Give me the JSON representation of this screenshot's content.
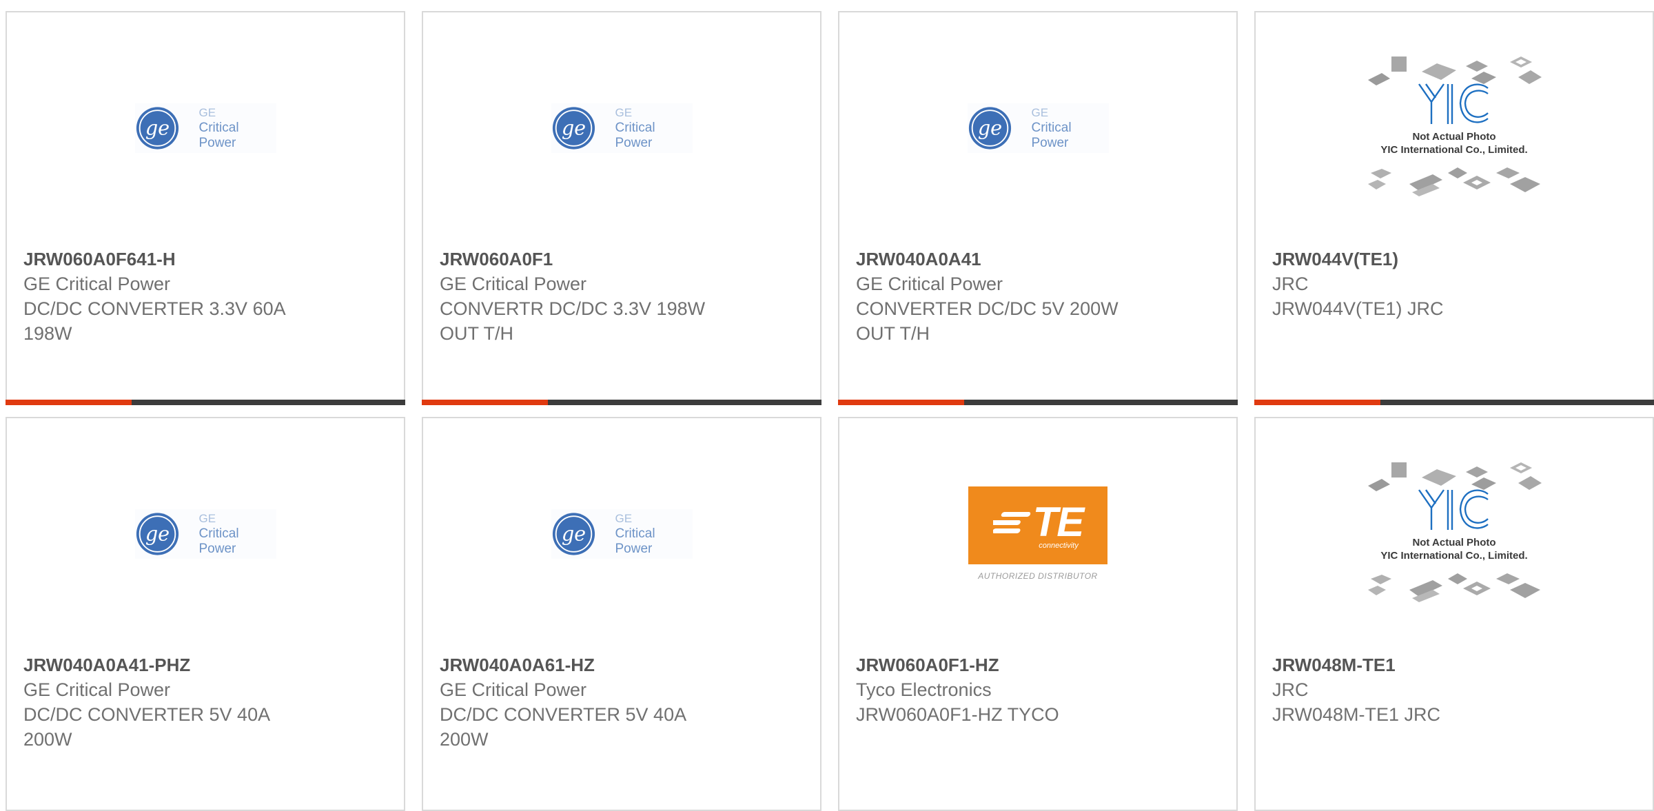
{
  "colors": {
    "accent": "#e03a10",
    "bar_dark": "#3c3c3c",
    "te_orange": "#f08a1c",
    "ge_blue": "#3d6fb6",
    "yic_blue": "#1d6fc1"
  },
  "cards": [
    {
      "part": "JRW060A0F641-H",
      "manufacturer": "GE Critical Power",
      "description": "DC/DC CONVERTER 3.3V 60A 198W",
      "logo": "ge",
      "logo_text": [
        "GE",
        "Critical Power"
      ]
    },
    {
      "part": "JRW060A0F1",
      "manufacturer": "GE Critical Power",
      "description": "CONVERTR DC/DC 3.3V 198W OUT T/H",
      "logo": "ge",
      "logo_text": [
        "GE",
        "Critical Power"
      ]
    },
    {
      "part": "JRW040A0A41",
      "manufacturer": "GE Critical Power",
      "description": "CONVERTER DC/DC 5V 200W OUT T/H",
      "logo": "ge",
      "logo_text": [
        "GE",
        "Critical Power"
      ]
    },
    {
      "part": "JRW044V(TE1)",
      "manufacturer": "JRC",
      "description": "JRW044V(TE1) JRC",
      "logo": "yic",
      "logo_text": [
        "Not Actual Photo",
        "YIC International Co., Limited."
      ]
    },
    {
      "part": "JRW040A0A41-PHZ",
      "manufacturer": "GE Critical Power",
      "description": "DC/DC CONVERTER 5V 40A 200W",
      "logo": "ge",
      "logo_text": [
        "GE",
        "Critical Power"
      ]
    },
    {
      "part": "JRW040A0A61-HZ",
      "manufacturer": "GE Critical Power",
      "description": "DC/DC CONVERTER 5V 40A 200W",
      "logo": "ge",
      "logo_text": [
        "GE",
        "Critical Power"
      ]
    },
    {
      "part": "JRW060A0F1-HZ",
      "manufacturer": "Tyco Electronics",
      "description": "JRW060A0F1-HZ TYCO",
      "logo": "te",
      "logo_text": [
        "TE",
        "connectivity",
        "AUTHORIZED DISTRIBUTOR"
      ]
    },
    {
      "part": "JRW048M-TE1",
      "manufacturer": "JRC",
      "description": "JRW048M-TE1 JRC",
      "logo": "yic",
      "logo_text": [
        "Not Actual Photo",
        "YIC International Co., Limited."
      ]
    }
  ]
}
